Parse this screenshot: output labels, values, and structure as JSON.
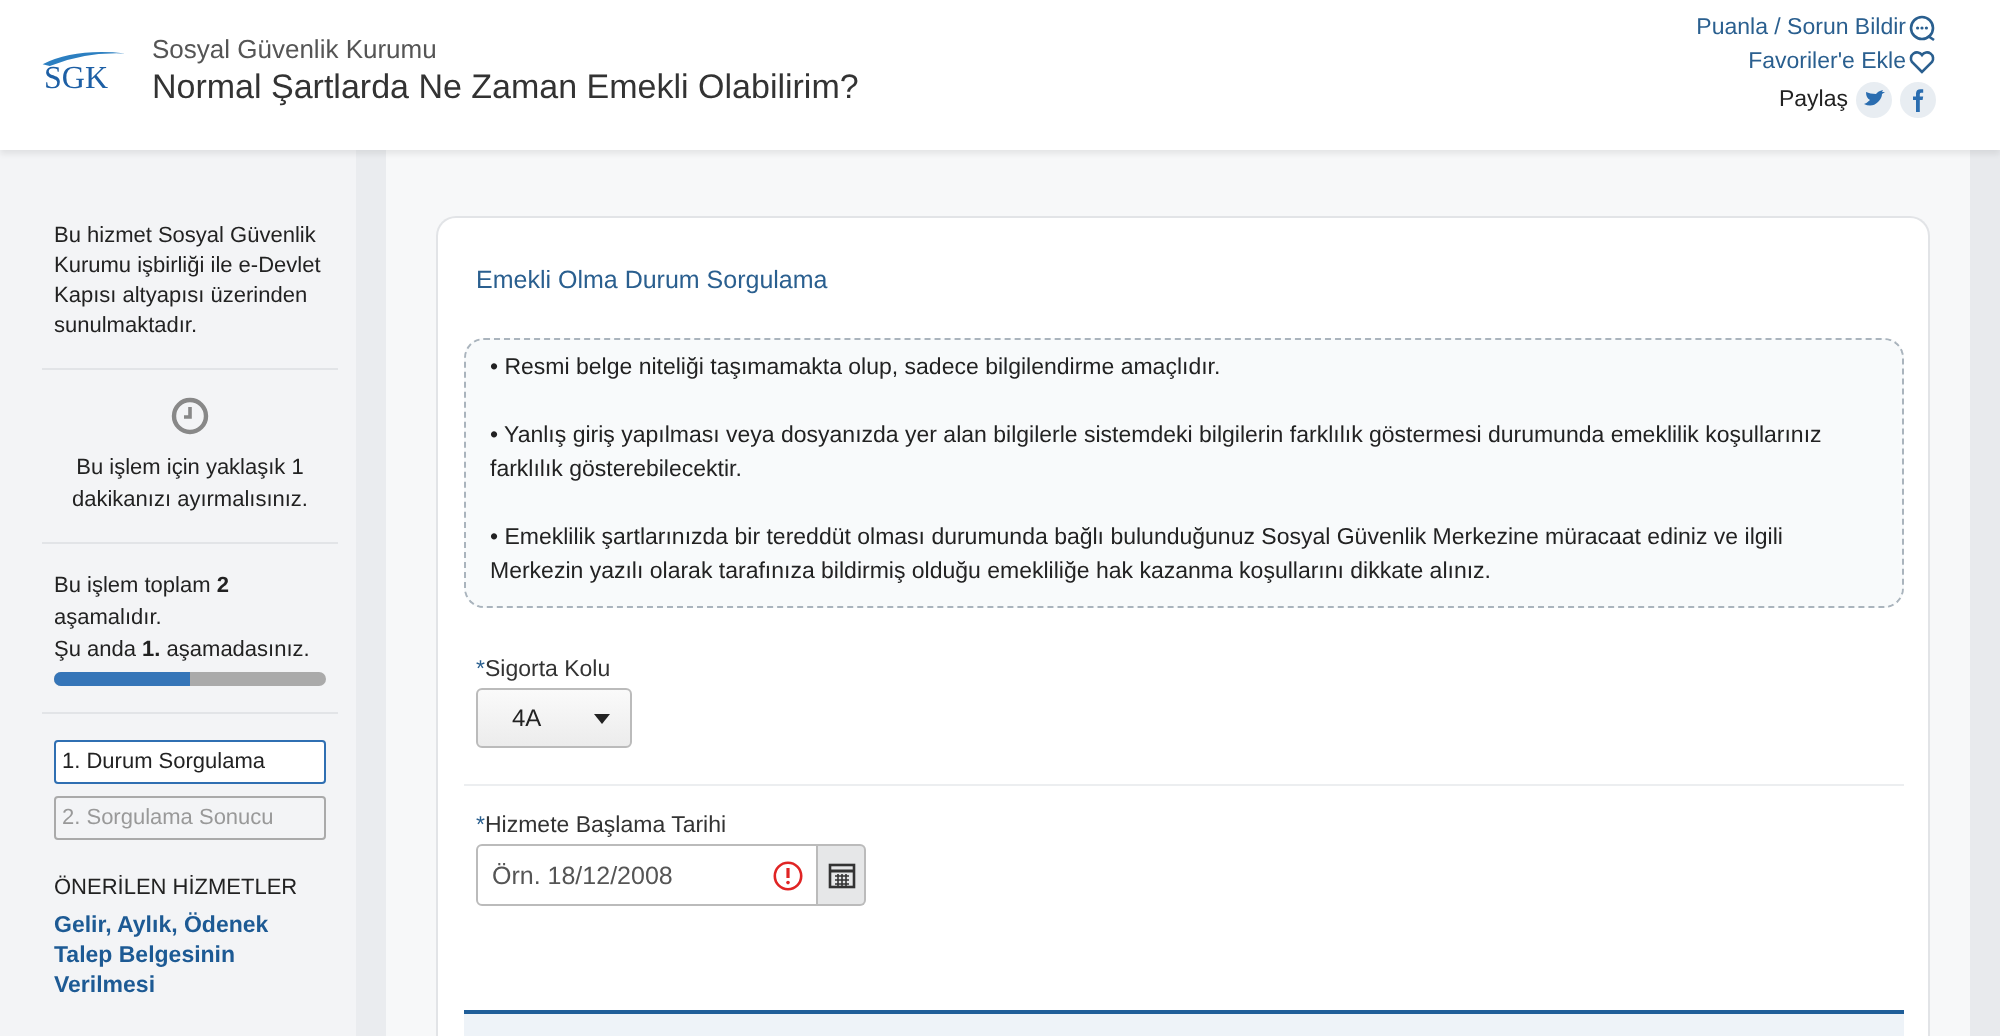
{
  "header": {
    "logo": "SGK",
    "agency": "Sosyal Güvenlik Kurumu",
    "title": "Normal Şartlarda Ne Zaman Emekli Olabilirim?",
    "links": [
      {
        "label": "Puanla / Sorun Bildir"
      },
      {
        "label": "Favoriler'e Ekle"
      }
    ],
    "share": {
      "label": "Paylaş"
    }
  },
  "sidebar": {
    "info": "Bu hizmet Sosyal Güvenlik Kurumu işbirliği ile e-Devlet Kapısı altyapısı üzerinden sunulmaktadır.",
    "duration": "Bu işlem için yaklaşık 1 dakikanızı ayırmalısınız.",
    "stage_lines": [
      "Bu işlem toplam **2** aşamalıdır.",
      "Şu anda **1.** aşamadasınız."
    ],
    "progress": {
      "level": 0.5
    },
    "steps": [
      {
        "label": "1. Durum Sorgulama",
        "selected": true
      },
      {
        "label": "2. Sorgulama Sonucu",
        "selected": false
      }
    ],
    "recommended_title": "ÖNERİLEN HİZMETLER",
    "recommended": [
      "Gelir, Aylık, Ödenek Talep Belgesinin Verilmesi"
    ]
  },
  "card": {
    "title": "Emekli Olma Durum Sorgulama",
    "notes": [
      "• Resmi belge niteliği taşımamakta olup, sadece bilgilendirme amaçlıdır.",
      "• Yanlış giriş yapılması veya dosyanızda yer alan bilgilerle sistemdeki bilgilerin farklılık göstermesi durumunda emeklilik koşullarınız farklılık gösterebilecektir.",
      "• Emeklilik şartlarınızda bir tereddüt olması durumunda bağlı bulunduğunuz Sosyal Güvenlik Merkezine müracaat ediniz ve ilgili Merkezin yazılı olarak tarafınıza bildirmiş olduğu emekliliğe hak kazanma koşullarını dikkate alınız."
    ],
    "fields": [
      {
        "kind": "select",
        "mark": "*",
        "label": "Sigorta Kolu",
        "value": "4A"
      },
      {
        "kind": "date",
        "mark": "*",
        "label": "Hizmete Başlama Tarihi",
        "placeholder": "Örn. 18/12/2008",
        "error": true
      }
    ]
  }
}
